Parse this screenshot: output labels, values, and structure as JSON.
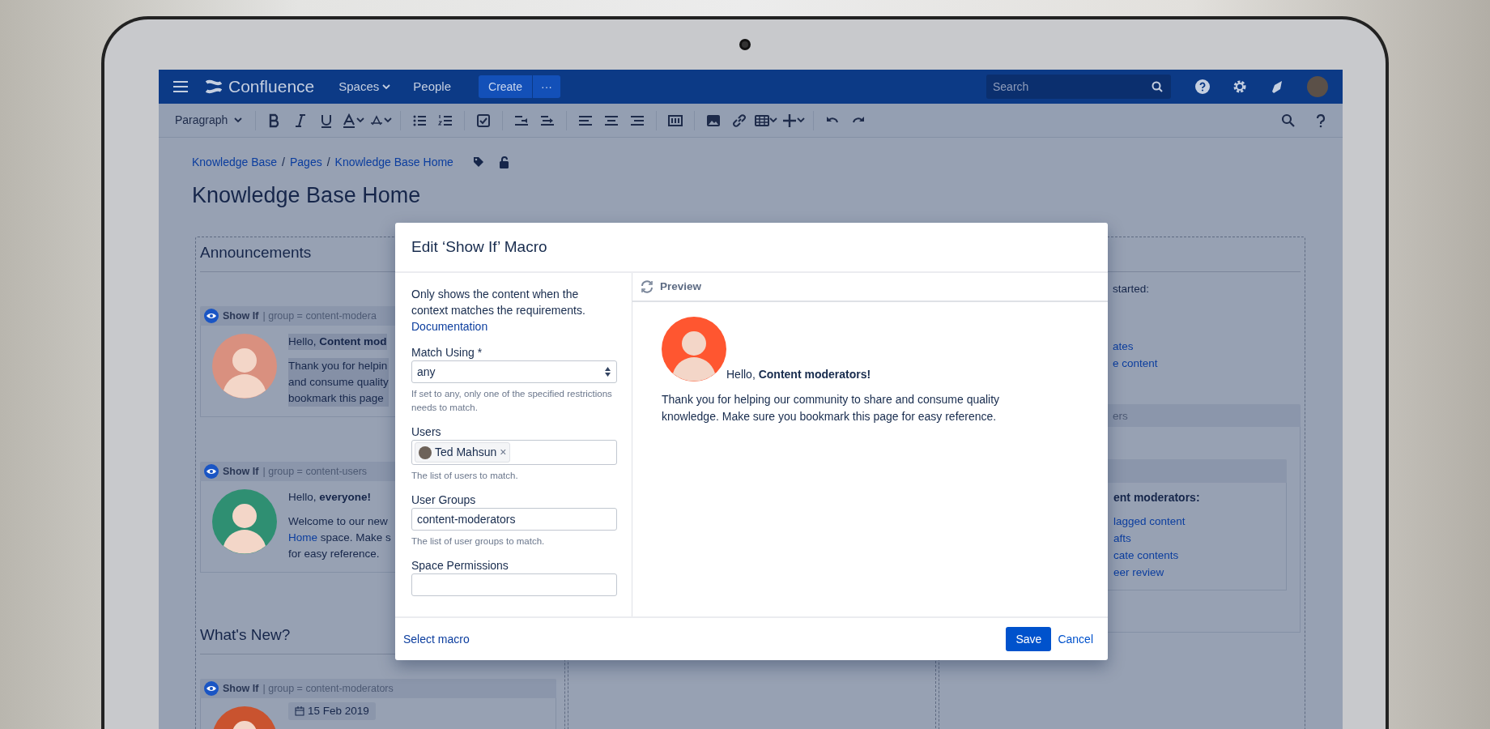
{
  "top_bar": {
    "logo": "Confluence",
    "menu": [
      {
        "label": "Spaces",
        "dropdown": true
      },
      {
        "label": "People",
        "dropdown": false
      }
    ],
    "create_button": "Create",
    "more_button": "···",
    "search": {
      "placeholder": "Search"
    }
  },
  "toolbar": {
    "paragraph_style": "Paragraph"
  },
  "breadcrumbs": {
    "separator": "/",
    "items": [
      "Knowledge Base",
      "Pages",
      "Knowledge Base Home"
    ]
  },
  "page_title": "Knowledge Base Home",
  "left_column": {
    "heading": "Announcements",
    "section_heading": "What's New?",
    "macros": [
      {
        "label": "Show If",
        "condition": "| group = content-modera",
        "selected": true,
        "color": "#d9907f",
        "greeting": "Hello, **Content mod**",
        "lines": [
          [
            {
              "text": "Thank you for helpin",
              "link": false
            }
          ],
          [
            {
              "text": "and consume quality",
              "link": false
            }
          ],
          [
            {
              "text": "bookmark this page",
              "link": false
            }
          ]
        ]
      },
      {
        "label": "Show If",
        "condition": "| group = content-users",
        "selected": false,
        "color": "#2f8f72",
        "greeting": "Hello, **everyone!**",
        "lines": [
          [
            {
              "text": "Welcome to our new",
              "link": false
            }
          ],
          [
            {
              "text": "Home",
              "link": true
            },
            {
              "text": " space. Make s",
              "link": false
            }
          ],
          [
            {
              "text": "for easy reference.",
              "link": false
            }
          ]
        ]
      }
    ],
    "bottom_macro": {
      "label": "Show If",
      "condition": "| group = content-moderators",
      "color": "#c9532f",
      "date": "15 Feb 2019"
    }
  },
  "right_column": {
    "intro": "started:",
    "links": [
      "ates",
      "e content"
    ],
    "macro_condition": "ers",
    "inner_heading": "ent moderators:",
    "inner_links": [
      "lagged content",
      "afts",
      "cate contents",
      "eer review"
    ]
  },
  "dialog": {
    "title": "Edit ‘Show If’ Macro",
    "description": "Only shows the content when the context matches the requirements.",
    "doc_link": "Documentation",
    "fields": [
      {
        "kind": "select",
        "label": "Match Using *",
        "value": "any",
        "help": "If set to any, only one of the specified restrictions needs to match."
      },
      {
        "kind": "users",
        "label": "Users",
        "tokens": [
          {
            "name": "Ted Mahsun",
            "remove": "×"
          }
        ],
        "help": "The list of users to match."
      },
      {
        "kind": "text",
        "label": "User Groups",
        "value": "content-moderators",
        "help": "The list of user groups to match."
      },
      {
        "kind": "text",
        "label": "Space Permissions"
      }
    ],
    "preview": {
      "label": "Preview",
      "color": "#ff5630",
      "greeting": "Hello, **Content moderators!**",
      "body": "Thank you for helping our community to share and consume quality knowledge. Make sure you bookmark this page for easy reference."
    },
    "footer": {
      "select_macro": "Select macro",
      "save": "Save",
      "cancel": "Cancel"
    }
  }
}
